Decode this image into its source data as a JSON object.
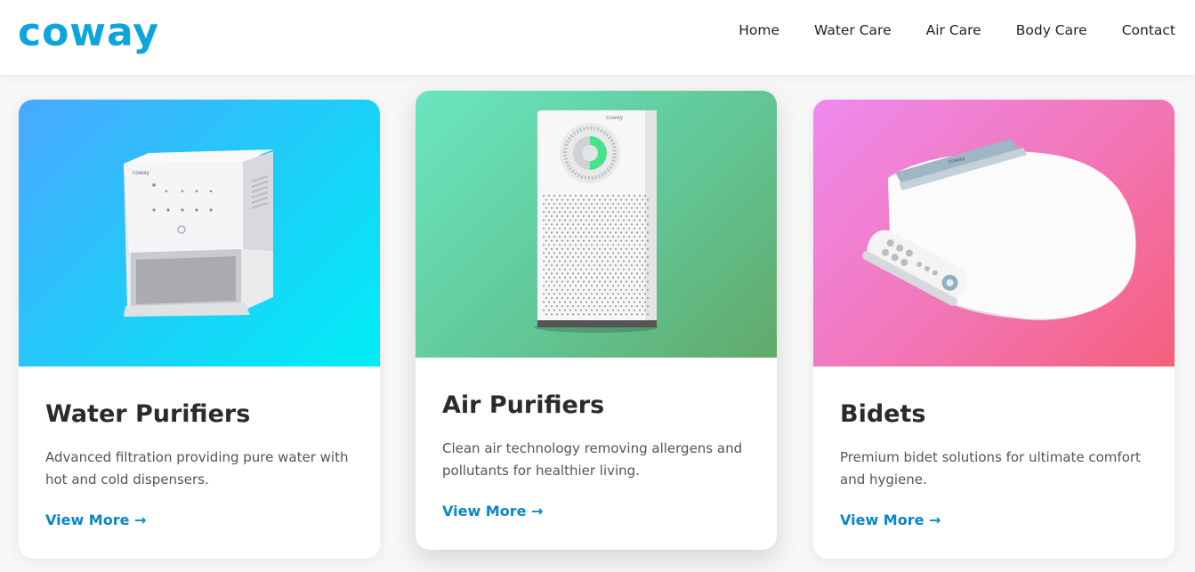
{
  "brand": {
    "logo_text": "coway",
    "color": "#0ea4dc"
  },
  "nav": {
    "items": [
      {
        "label": "Home"
      },
      {
        "label": "Water Care"
      },
      {
        "label": "Air Care"
      },
      {
        "label": "Body Care"
      },
      {
        "label": "Contact"
      }
    ]
  },
  "cards": [
    {
      "title": "Water Purifiers",
      "description": "Advanced filtration providing pure water with hot and cold dispensers.",
      "link_label": "View More →",
      "product_brand": "coway",
      "gradient": [
        "#4aa8ff",
        "#00eef6"
      ]
    },
    {
      "title": "Air Purifiers",
      "description": "Clean air technology removing allergens and pollutants for healthier living.",
      "link_label": "View More →",
      "product_brand": "coway",
      "gradient": [
        "#69e6c0",
        "#62a96a"
      ]
    },
    {
      "title": "Bidets",
      "description": "Premium bidet solutions for ultimate comfort and hygiene.",
      "link_label": "View More →",
      "product_brand": "coway",
      "gradient": [
        "#ee8aee",
        "#f55f7b"
      ]
    }
  ],
  "accent_link_color": "#0a86c8"
}
